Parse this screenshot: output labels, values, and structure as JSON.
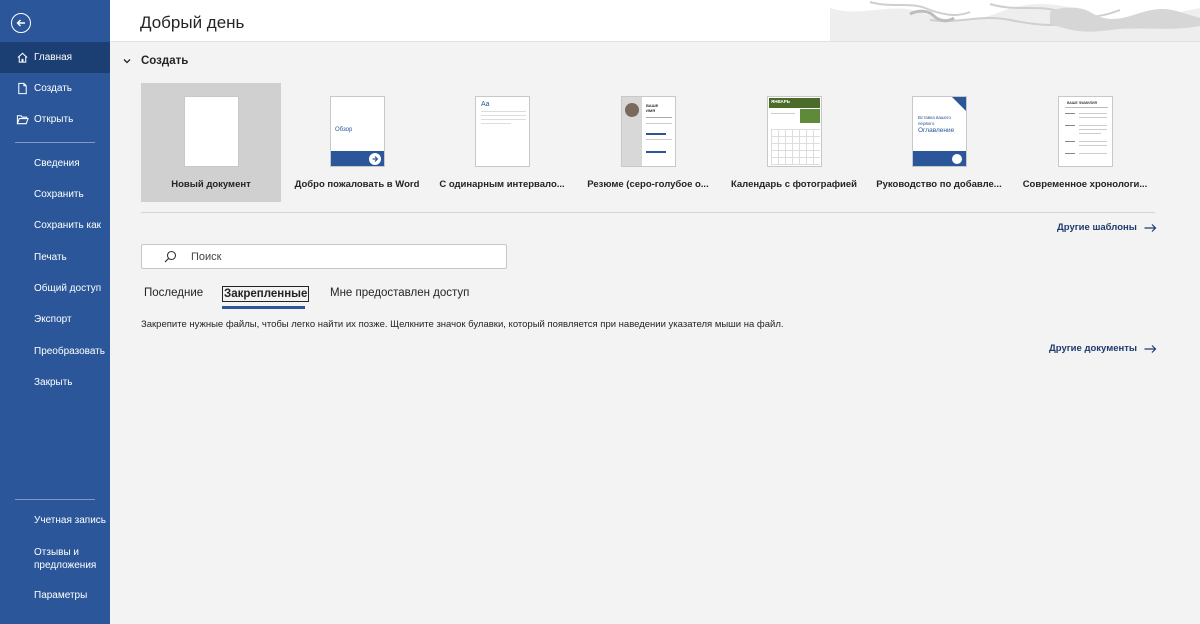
{
  "sidebar": {
    "back_icon": "back-arrow-icon",
    "items": [
      {
        "label": "Главная",
        "icon": "home-icon",
        "active": true
      },
      {
        "label": "Создать",
        "icon": "new-document-icon"
      },
      {
        "label": "Открыть",
        "icon": "folder-open-icon"
      },
      {
        "label": "Сведения"
      },
      {
        "label": "Сохранить"
      },
      {
        "label": "Сохранить как"
      },
      {
        "label": "Печать"
      },
      {
        "label": "Общий доступ"
      },
      {
        "label": "Экспорт"
      },
      {
        "label": "Преобразовать"
      },
      {
        "label": "Закрыть"
      }
    ],
    "bottom_items": [
      {
        "label": "Учетная запись"
      },
      {
        "label_line1": "Отзывы и",
        "label_line2": "предложения"
      },
      {
        "label": "Параметры"
      }
    ]
  },
  "header": {
    "greeting": "Добрый день"
  },
  "create": {
    "label": "Создать",
    "templates": [
      {
        "label": "Новый документ",
        "selected": true
      },
      {
        "label": "Добро пожаловать в Word",
        "thumb_text": "Обзор"
      },
      {
        "label": "С одинарным интервало...",
        "thumb_text": "Aa"
      },
      {
        "label": "Резюме (серо-голубое о...",
        "thumb_text_1": "ВАШЕ",
        "thumb_text_2": "ИМЯ"
      },
      {
        "label": "Календарь с фотографией",
        "thumb_text": "ЯНВАРЬ"
      },
      {
        "label": "Руководство по добавле...",
        "thumb_text_1": "Вставка вашего",
        "thumb_text_2": "первого",
        "thumb_text_3": "Оглавление"
      },
      {
        "label": "Современное хронологи...",
        "thumb_text": "ВАШЕ ФАМИЛИЯ"
      }
    ],
    "more_templates": "Другие шаблоны"
  },
  "search": {
    "placeholder": "Поиск"
  },
  "tabs": [
    {
      "label": "Последние"
    },
    {
      "label": "Закрепленные",
      "active": true
    },
    {
      "label": "Мне предоставлен доступ"
    }
  ],
  "pinned_hint": "Закрепите нужные файлы, чтобы легко найти их позже. Щелкните значок булавки, который появляется при наведении указателя мыши на файл.",
  "more_documents": "Другие документы",
  "colors": {
    "sidebar": "#2b579a",
    "sidebar_active": "#1b3e73",
    "accent": "#2b579a",
    "calendar_green": "#4b6b2a"
  }
}
